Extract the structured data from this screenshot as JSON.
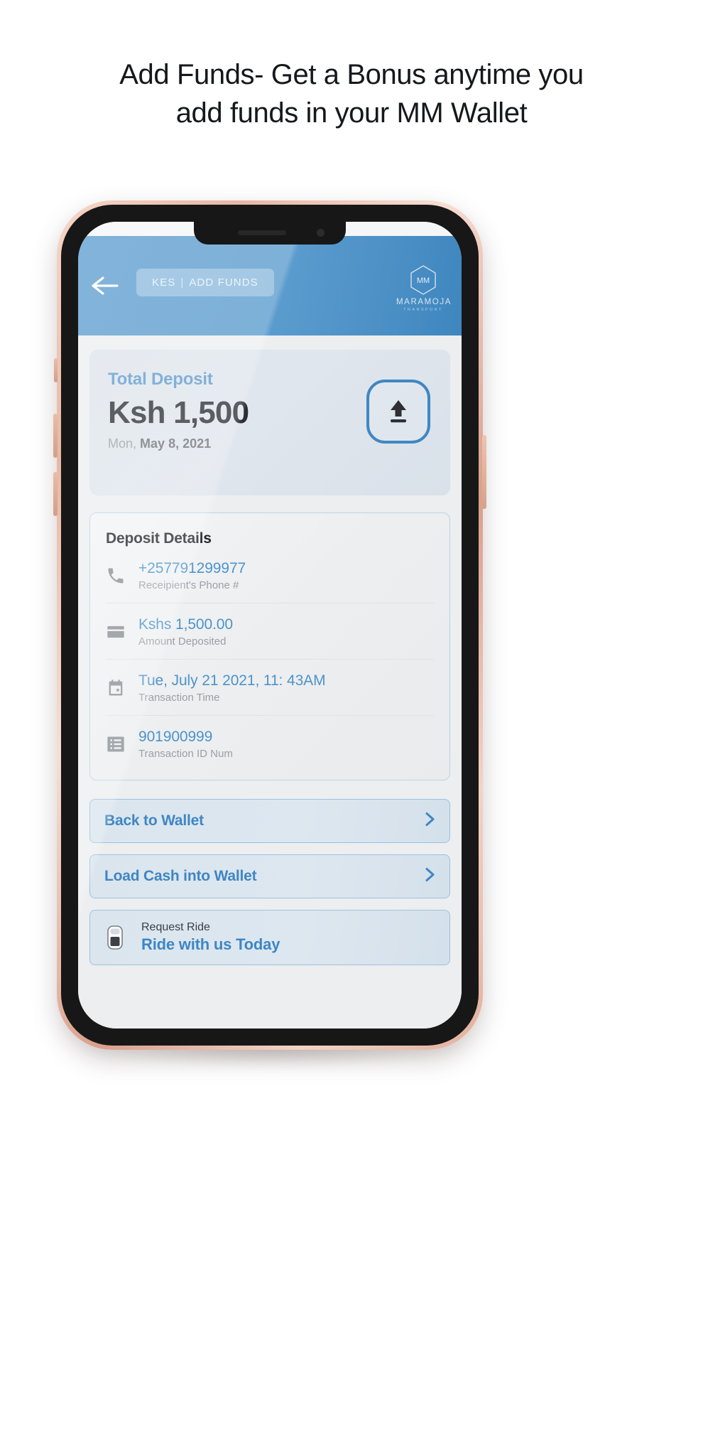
{
  "headline": {
    "line1": "Add Funds- Get a Bonus anytime you",
    "line2": "add funds in your MM Wallet"
  },
  "app": {
    "header": {
      "back_icon": "arrow-left-icon",
      "pill": {
        "currency": "KES",
        "separator": "|",
        "action": "ADD FUNDS"
      },
      "brand": {
        "mark": "MM",
        "name": "MARAMOJA",
        "tagline": "TRANSPORT"
      }
    },
    "deposit_card": {
      "label": "Total Deposit",
      "amount": "Ksh 1,500",
      "date_prefix": "Mon,",
      "date_strong": "May 8, 2021",
      "upload_icon": "upload-arrow-icon"
    },
    "details": {
      "title": "Deposit Details",
      "rows": [
        {
          "icon": "phone-icon",
          "value": "+257791299977",
          "label": "Receipient's Phone #"
        },
        {
          "icon": "card-icon",
          "value": "Kshs 1,500.00",
          "label": "Amount Deposited"
        },
        {
          "icon": "calendar-icon",
          "value": "Tue, July 21 2021, 11: 43AM",
          "label": "Transaction Time"
        },
        {
          "icon": "list-icon",
          "value": "901900999",
          "label": "Transaction ID Num"
        }
      ]
    },
    "actions": {
      "back_to_wallet": "Back to Wallet",
      "load_cash": "Load Cash into Wallet",
      "ride_title": "Request Ride",
      "ride_sub": "Ride with us Today"
    }
  },
  "colors": {
    "header_blue": "#5b9ccf",
    "accent_blue": "#3f86c3",
    "value_blue": "#4e93c9",
    "muted_gray": "#9ba0a5",
    "card_bg": "#dde4ec",
    "screen_bg": "#eceef0"
  }
}
